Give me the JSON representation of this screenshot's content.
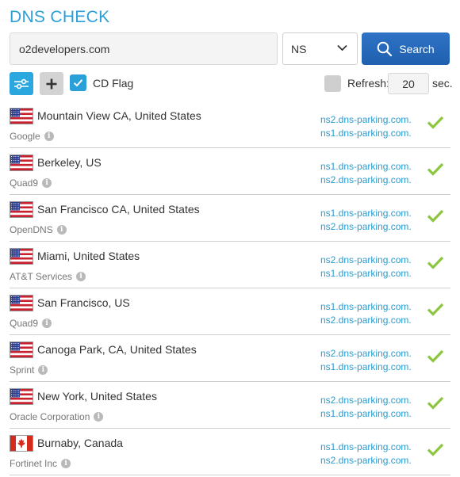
{
  "header": {
    "title": "DNS CHECK"
  },
  "search": {
    "domain": "o2developers.com",
    "record_type": "NS",
    "button_label": "Search"
  },
  "options": {
    "cd_flag_label": "CD Flag",
    "cd_flag_checked": true,
    "refresh_label": "Refresh:",
    "refresh_value": "20",
    "refresh_unit": "sec.",
    "refresh_checked": false
  },
  "colors": {
    "accent": "#2c9fd9",
    "search_button": "#2465b8",
    "link": "#2a9ccf",
    "ok": "#8cc63f"
  },
  "results": [
    {
      "flag": "us",
      "location": "Mountain View CA, United States",
      "provider": "Google",
      "ns": [
        "ns2.dns-parking.com.",
        "ns1.dns-parking.com."
      ],
      "status": "check-icon"
    },
    {
      "flag": "us",
      "location": "Berkeley, US",
      "provider": "Quad9",
      "ns": [
        "ns1.dns-parking.com.",
        "ns2.dns-parking.com."
      ],
      "status": "check-icon"
    },
    {
      "flag": "us",
      "location": "San Francisco CA, United States",
      "provider": "OpenDNS",
      "ns": [
        "ns1.dns-parking.com.",
        "ns2.dns-parking.com."
      ],
      "status": "check-icon"
    },
    {
      "flag": "us",
      "location": "Miami, United States",
      "provider": "AT&T Services",
      "ns": [
        "ns2.dns-parking.com.",
        "ns1.dns-parking.com."
      ],
      "status": "check-icon"
    },
    {
      "flag": "us",
      "location": "San Francisco, US",
      "provider": "Quad9",
      "ns": [
        "ns1.dns-parking.com.",
        "ns2.dns-parking.com."
      ],
      "status": "check-icon"
    },
    {
      "flag": "us",
      "location": "Canoga Park, CA, United States",
      "provider": "Sprint",
      "ns": [
        "ns2.dns-parking.com.",
        "ns1.dns-parking.com."
      ],
      "status": "check-icon"
    },
    {
      "flag": "us",
      "location": "New York, United States",
      "provider": "Oracle Corporation",
      "ns": [
        "ns2.dns-parking.com.",
        "ns1.dns-parking.com."
      ],
      "status": "check-icon"
    },
    {
      "flag": "ca",
      "location": "Burnaby, Canada",
      "provider": "Fortinet Inc",
      "ns": [
        "ns1.dns-parking.com.",
        "ns2.dns-parking.com."
      ],
      "status": "check-icon"
    }
  ]
}
